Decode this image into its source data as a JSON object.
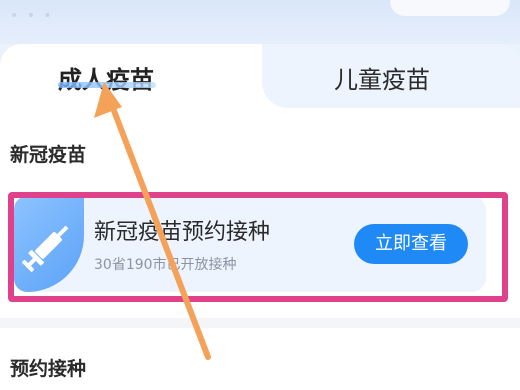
{
  "tabs": {
    "adult": "成人疫苗",
    "child": "儿童疫苗"
  },
  "sections": {
    "covid_title": "新冠疫苗",
    "booking_title": "预约接种"
  },
  "card": {
    "title": "新冠疫苗预约接种",
    "subtitle": "30省190市已开放接种",
    "cta": "立即查看",
    "icon": "syringe-icon"
  },
  "annotation": {
    "arrow_color": "#f4a25a",
    "highlight_color": "#e0418b"
  }
}
